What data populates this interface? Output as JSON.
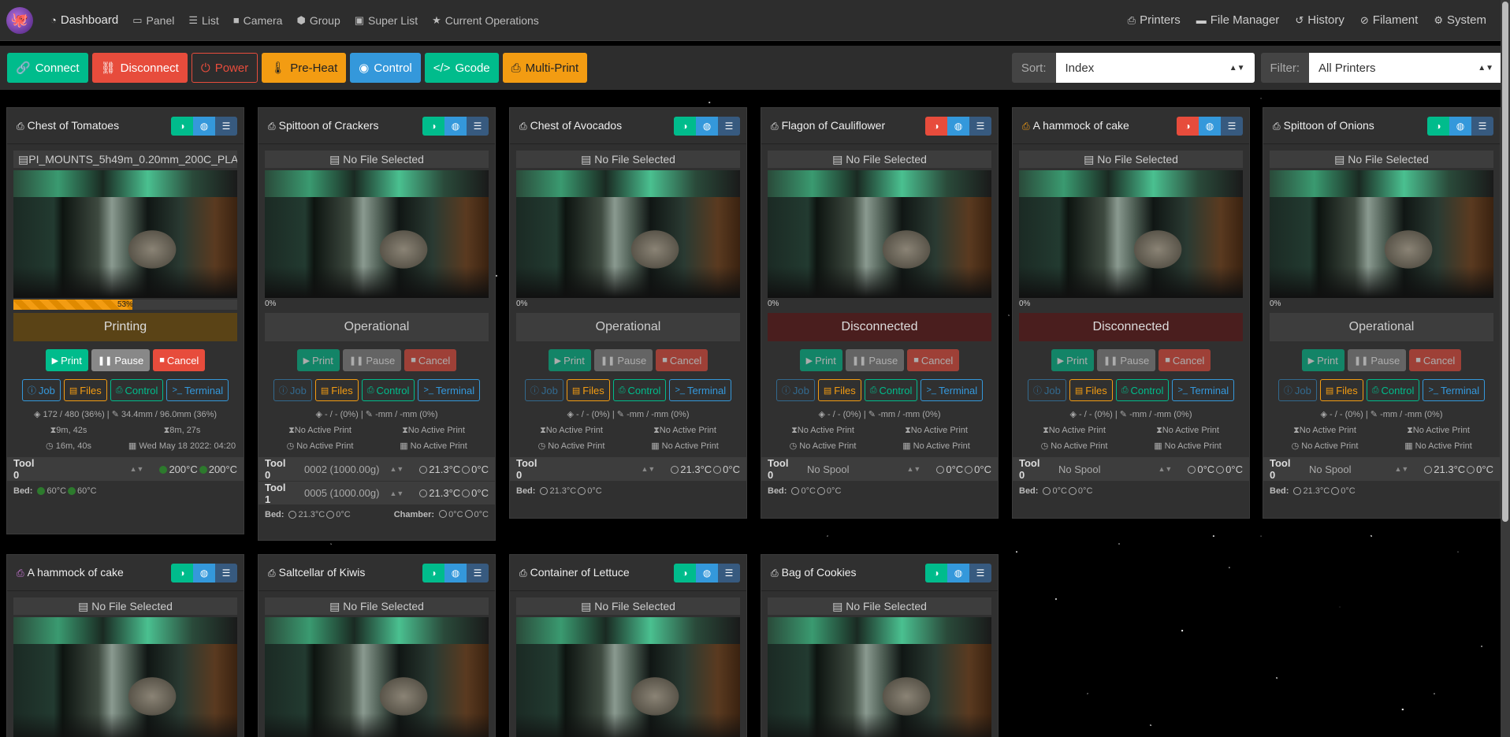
{
  "nav": {
    "left": [
      {
        "icon": "tachometer-icon",
        "glyph": "◔",
        "label": "Dashboard"
      },
      {
        "icon": "panel-icon",
        "glyph": "▭",
        "label": "Panel"
      },
      {
        "icon": "list-icon",
        "glyph": "☰",
        "label": "List"
      },
      {
        "icon": "camera-icon",
        "glyph": "■",
        "label": "Camera"
      },
      {
        "icon": "group-icon",
        "glyph": "⬢",
        "label": "Group"
      },
      {
        "icon": "super-list-icon",
        "glyph": "▣",
        "label": "Super List"
      },
      {
        "icon": "star-icon",
        "glyph": "★",
        "label": "Current Operations"
      }
    ],
    "right": [
      {
        "icon": "print-icon",
        "glyph": "⎙",
        "label": "Printers"
      },
      {
        "icon": "folder-icon",
        "glyph": "▬",
        "label": "File Manager"
      },
      {
        "icon": "history-icon",
        "glyph": "↺",
        "label": "History"
      },
      {
        "icon": "filament-icon",
        "glyph": "⊘",
        "label": "Filament"
      },
      {
        "icon": "cogs-icon",
        "glyph": "⚙",
        "label": "System"
      }
    ]
  },
  "toolbar": {
    "connect": "Connect",
    "disconnect": "Disconnect",
    "power": "Power",
    "preheat": "Pre-Heat",
    "control": "Control",
    "gcode": "Gcode",
    "multiprint": "Multi-Print",
    "sort_label": "Sort:",
    "sort_value": "Index",
    "filter_label": "Filter:",
    "filter_value": "All Printers"
  },
  "common": {
    "no_file": "No File Selected",
    "print": "Print",
    "pause": "Pause",
    "cancel": "Cancel",
    "job": "Job",
    "files": "Files",
    "control": "Control",
    "terminal": "Terminal",
    "no_active": "No Active Print",
    "bed": "Bed:",
    "chamber": "Chamber:",
    "tool0": "Tool 0",
    "tool1": "Tool 1",
    "no_spool": "No Spool",
    "zero_pct": "0%"
  },
  "printers": [
    {
      "name": "Chest of Tomatoes",
      "file": "PI_MOUNTS_5h49m_0.20mm_200C_PLA_...",
      "progress": 53,
      "progress_label": "53%",
      "state": "Printing",
      "layer": "172 / 480 (36%)",
      "height": "34.4mm / 96.0mm (36%)",
      "elapsed": "9m, 42s",
      "remaining": "8m, 27s",
      "total": "16m, 40s",
      "eta": "Wed May 18 2022: 04:20",
      "tool0_temp": "200°C",
      "tool0_target": "200°C",
      "bed_temp": "60°C",
      "bed_target": "60°C"
    },
    {
      "name": "Spittoon of Crackers",
      "state": "Operational",
      "layer": "- / - (0%)",
      "height": "-mm / -mm (0%)",
      "tool0_spool": "0002 (1000.00g)",
      "tool1_spool": "0005 (1000.00g)",
      "tool0_temp": "21.3°C",
      "tool0_target": "0°C",
      "tool1_temp": "21.3°C",
      "tool1_target": "0°C",
      "bed_temp": "21.3°C",
      "bed_target": "0°C",
      "chamber_temp": "0°C",
      "chamber_target": "0°C"
    },
    {
      "name": "Chest of Avocados",
      "state": "Operational",
      "layer": "- / - (0%)",
      "height": "-mm / -mm (0%)",
      "tool0_temp": "21.3°C",
      "tool0_target": "0°C",
      "bed_temp": "21.3°C",
      "bed_target": "0°C"
    },
    {
      "name": "Flagon of Cauliflower",
      "state": "Disconnected",
      "layer": "- / - (0%)",
      "height": "-mm / -mm (0%)",
      "tool0_temp": "0°C",
      "tool0_target": "0°C",
      "bed_temp": "0°C",
      "bed_target": "0°C"
    },
    {
      "name": "A hammock of cake",
      "state": "Disconnected",
      "layer": "- / - (0%)",
      "height": "-mm / -mm (0%)",
      "tool0_temp": "0°C",
      "tool0_target": "0°C",
      "bed_temp": "0°C",
      "bed_target": "0°C"
    },
    {
      "name": "Spittoon of Onions",
      "state": "Operational",
      "layer": "- / - (0%)",
      "height": "-mm / -mm (0%)",
      "tool0_temp": "21.3°C",
      "tool0_target": "0°C",
      "bed_temp": "21.3°C",
      "bed_target": "0°C"
    },
    {
      "name": "A hammock of cake"
    },
    {
      "name": "Saltcellar of Kiwis"
    },
    {
      "name": "Container of Lettuce"
    },
    {
      "name": "Bag of Cookies"
    }
  ],
  "colors": {
    "accent_green": "#00bc8c",
    "danger": "#e74c3c",
    "warning": "#f39c12",
    "info": "#3498db"
  }
}
